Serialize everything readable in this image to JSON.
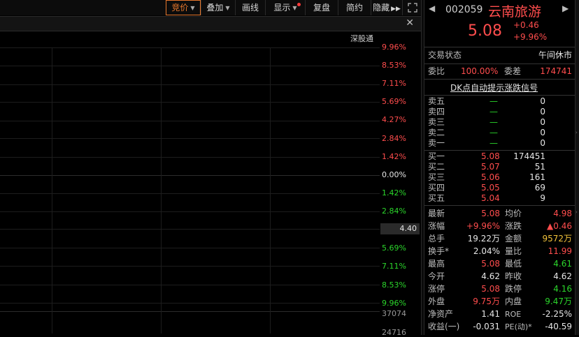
{
  "toolbar": {
    "buttons": [
      {
        "label": "竞价",
        "dropdown": true
      },
      {
        "label": "叠加",
        "dropdown": true
      },
      {
        "label": "画线"
      },
      {
        "label": "显示",
        "dropdown": true
      },
      {
        "label": "复盘"
      },
      {
        "label": "简约"
      },
      {
        "label": "隐藏"
      }
    ],
    "expand_icon": "double-chevron-right-icon",
    "fullscreen_icon": "fullscreen-icon"
  },
  "chart": {
    "connect_label": "深股通",
    "price_levels": [
      "9.96%",
      "8.53%",
      "7.11%",
      "5.69%",
      "4.27%",
      "2.84%",
      "1.42%",
      "0.00%",
      "1.42%",
      "2.84%",
      "4.40",
      "5.69%",
      "7.11%",
      "8.53%",
      "9.96%"
    ],
    "volume_levels": [
      "37074",
      "24716"
    ]
  },
  "stock": {
    "code": "002059",
    "name": "云南旅游",
    "price": "5.08",
    "change": "+0.46",
    "change_pct": "+9.96%"
  },
  "status": {
    "label": "交易状态",
    "value": "午间休市",
    "wei_bi_label": "委比",
    "wei_bi_value": "100.00%",
    "wei_cha_label": "委差",
    "wei_cha_value": "174741"
  },
  "signal_link": "DK点自动提示涨跌信号",
  "sell_orders": [
    {
      "label": "卖五",
      "price": "—",
      "volume": "0"
    },
    {
      "label": "卖四",
      "price": "—",
      "volume": "0"
    },
    {
      "label": "卖三",
      "price": "—",
      "volume": "0"
    },
    {
      "label": "卖二",
      "price": "—",
      "volume": "0"
    },
    {
      "label": "卖一",
      "price": "—",
      "volume": "0"
    }
  ],
  "buy_orders": [
    {
      "label": "买一",
      "price": "5.08",
      "volume": "174451"
    },
    {
      "label": "买二",
      "price": "5.07",
      "volume": "51"
    },
    {
      "label": "买三",
      "price": "5.06",
      "volume": "161"
    },
    {
      "label": "买四",
      "price": "5.05",
      "volume": "69"
    },
    {
      "label": "买五",
      "price": "5.04",
      "volume": "9"
    }
  ],
  "stats": [
    {
      "l1": "最新",
      "v1": "5.08",
      "c1": "red",
      "l2": "均价",
      "v2": "4.98",
      "c2": "red"
    },
    {
      "l1": "涨幅",
      "v1": "+9.96%",
      "c1": "red",
      "l2": "涨跌",
      "v2": "▲0.46",
      "c2": "red"
    },
    {
      "l1": "总手",
      "v1": "19.22万",
      "c1": "white",
      "l2": "金额",
      "v2": "9572万",
      "c2": "yellow"
    },
    {
      "l1": "换手*",
      "v1": "2.04%",
      "c1": "white",
      "l2": "量比",
      "v2": "11.99",
      "c2": "red"
    },
    {
      "l1": "最高",
      "v1": "5.08",
      "c1": "red",
      "l2": "最低",
      "v2": "4.61",
      "c2": "green"
    },
    {
      "l1": "今开",
      "v1": "4.62",
      "c1": "white",
      "l2": "昨收",
      "v2": "4.62",
      "c2": "white"
    },
    {
      "l1": "涨停",
      "v1": "5.08",
      "c1": "red",
      "l2": "跌停",
      "v2": "4.16",
      "c2": "green"
    },
    {
      "l1": "外盘",
      "v1": "9.75万",
      "c1": "red",
      "l2": "内盘",
      "v2": "9.47万",
      "c2": "green"
    },
    {
      "l1": "净资产",
      "v1": "1.41",
      "c1": "white",
      "l2": "ROE",
      "v2": "-2.25%",
      "c2": "white"
    },
    {
      "l1": "收益(一)",
      "v1": "-0.031",
      "c1": "white",
      "l2": "PE(动)*",
      "v2": "-40.59",
      "c2": "white"
    }
  ],
  "colors": {
    "up": "#ff4d4d",
    "down": "#2bd62b",
    "accent": "#e8782d",
    "amount": "#f2c23a"
  }
}
